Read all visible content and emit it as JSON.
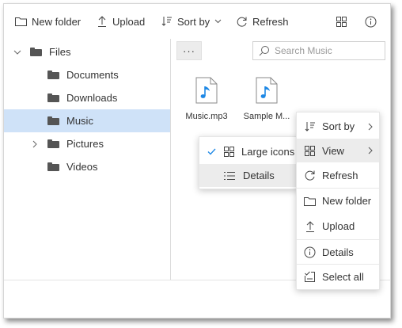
{
  "toolbar": {
    "new_folder": "New folder",
    "upload": "Upload",
    "sort_by": "Sort by",
    "refresh": "Refresh",
    "view_icon": "grid-icon",
    "details_icon": "info-icon"
  },
  "tree": {
    "root": "Files",
    "items": [
      {
        "label": "Documents"
      },
      {
        "label": "Downloads"
      },
      {
        "label": "Music",
        "selected": true
      },
      {
        "label": "Pictures",
        "expandable": true
      },
      {
        "label": "Videos"
      }
    ]
  },
  "content": {
    "more_label": "···",
    "search_placeholder": "Search Music",
    "files": [
      {
        "name": "Music.mp3"
      },
      {
        "name": "Sample M..."
      }
    ]
  },
  "context_menu": {
    "items": [
      {
        "label": "Sort by"
      },
      {
        "label": "View"
      },
      {
        "label": "Refresh"
      },
      {
        "label": "New folder"
      },
      {
        "label": "Upload"
      },
      {
        "label": "Details"
      },
      {
        "label": "Select all"
      }
    ]
  },
  "view_submenu": {
    "items": [
      {
        "label": "Large icons",
        "checked": true
      },
      {
        "label": "Details"
      }
    ]
  },
  "colors": {
    "selection": "#cfe2f8",
    "accent": "#1e88e5",
    "hover": "#ececec"
  }
}
